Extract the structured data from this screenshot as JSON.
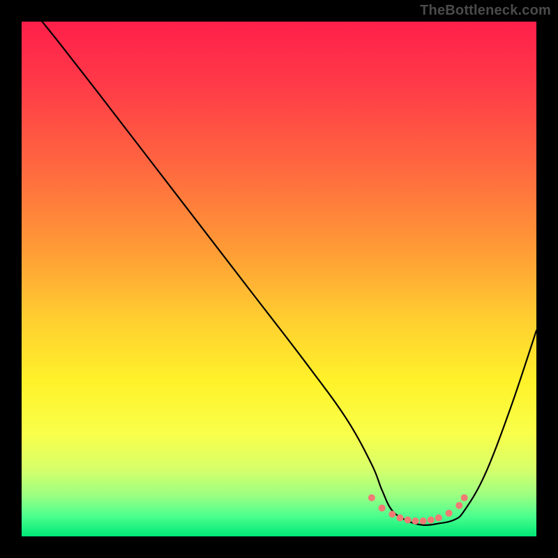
{
  "watermark": "TheBottleneck.com",
  "chart_data": {
    "type": "line",
    "title": "",
    "xlabel": "",
    "ylabel": "",
    "xlim": [
      0,
      100
    ],
    "ylim": [
      0,
      100
    ],
    "grid": false,
    "legend": false,
    "series": [
      {
        "name": "curve",
        "x": [
          4,
          8,
          15,
          25,
          35,
          45,
          55,
          63,
          68,
          70,
          72,
          75,
          78,
          81,
          84,
          86,
          90,
          95,
          100
        ],
        "y": [
          100,
          95,
          86,
          73,
          60,
          47,
          34,
          23,
          14,
          9,
          5,
          3,
          2.2,
          2.5,
          3.2,
          5,
          12,
          25,
          40
        ],
        "color": "#000000"
      }
    ],
    "markers": {
      "name": "valley-dots",
      "color": "#ef7b74",
      "x": [
        68,
        70,
        72,
        73.5,
        75,
        76.5,
        78,
        79.5,
        81,
        83,
        85,
        86
      ],
      "y": [
        7.5,
        5.5,
        4.3,
        3.6,
        3.2,
        3.0,
        3.0,
        3.2,
        3.6,
        4.5,
        6.0,
        7.5
      ]
    },
    "background_gradient": {
      "direction": "vertical",
      "stops": [
        {
          "pos": 0.0,
          "color": "#ff1f4a"
        },
        {
          "pos": 0.12,
          "color": "#ff3a48"
        },
        {
          "pos": 0.28,
          "color": "#ff6740"
        },
        {
          "pos": 0.44,
          "color": "#ff9a36"
        },
        {
          "pos": 0.58,
          "color": "#ffcf30"
        },
        {
          "pos": 0.7,
          "color": "#fff22a"
        },
        {
          "pos": 0.8,
          "color": "#f9ff4a"
        },
        {
          "pos": 0.87,
          "color": "#d6ff6a"
        },
        {
          "pos": 0.92,
          "color": "#9cff82"
        },
        {
          "pos": 0.96,
          "color": "#4dff8e"
        },
        {
          "pos": 1.0,
          "color": "#00e877"
        }
      ]
    }
  }
}
